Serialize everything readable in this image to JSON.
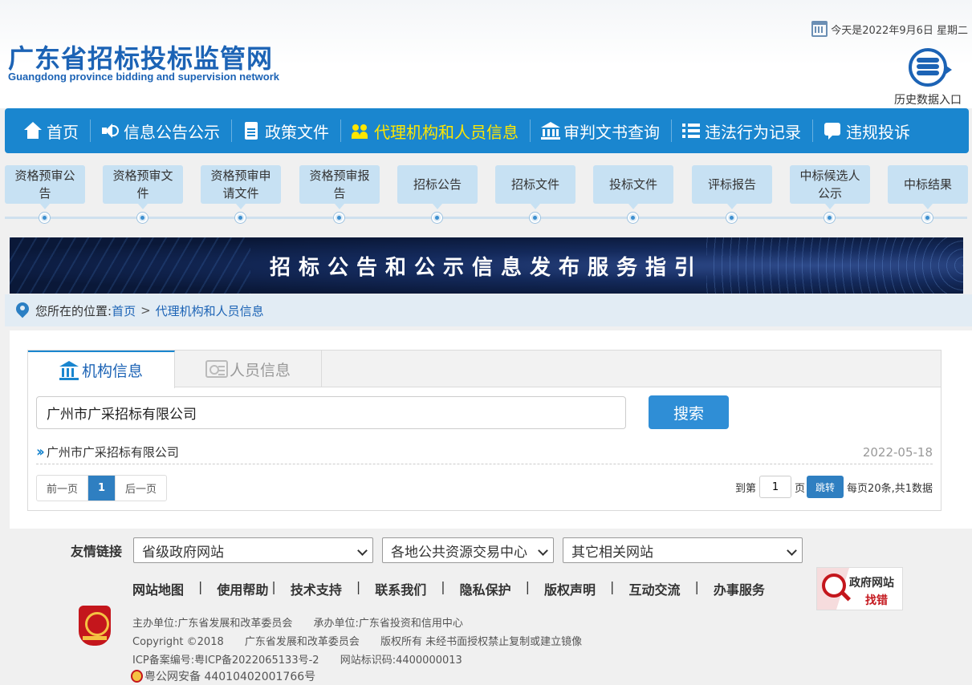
{
  "header": {
    "site_title": "广东省招标投标监管网",
    "site_subtitle": "Guangdong province bidding and supervision network",
    "date_text": "今天是2022年9月6日  星期二",
    "history_link": "历史数据入口"
  },
  "nav": {
    "items": [
      {
        "label": "首页",
        "icon": "home-icon"
      },
      {
        "label": "信息公告公示",
        "icon": "speaker-icon"
      },
      {
        "label": "政策文件",
        "icon": "document-icon"
      },
      {
        "label": "代理机构和人员信息",
        "icon": "people-icon",
        "active": true
      },
      {
        "label": "审判文书查询",
        "icon": "courthouse-icon"
      },
      {
        "label": "违法行为记录",
        "icon": "list-icon"
      },
      {
        "label": "违规投诉",
        "icon": "chat-icon"
      }
    ],
    "active_color": "#ffe600",
    "bar_color": "#1a86cf"
  },
  "steps": [
    "资格预审公告",
    "资格预审文件",
    "资格预审申请文件",
    "资格预审报告",
    "招标公告",
    "招标文件",
    "投标文件",
    "评标报告",
    "中标候选人公示",
    "中标结果"
  ],
  "banner": {
    "title": "招标公告和公示信息发布服务指引"
  },
  "breadcrumb": {
    "prefix": "您所在的位置:",
    "home": "首页",
    "separator": ">",
    "current": "代理机构和人员信息"
  },
  "tabs": [
    {
      "label": "机构信息",
      "icon": "bank-icon",
      "active": true
    },
    {
      "label": "人员信息",
      "icon": "id-card-icon",
      "active": false
    }
  ],
  "search": {
    "value": "广州市广采招标有限公司",
    "button_label": "搜索"
  },
  "results": [
    {
      "name": "广州市广采招标有限公司",
      "date": "2022-05-18"
    }
  ],
  "pagination": {
    "prev_label": "前一页",
    "current_page": "1",
    "next_label": "后一页",
    "jump_prefix": "到第",
    "jump_value": "1",
    "jump_suffix": "页",
    "jump_button": "跳转",
    "summary": "每页20条,共1数据"
  },
  "footer": {
    "links_label": "友情链接",
    "selects": [
      "省级政府网站",
      "各地公共资源交易中心",
      "其它相关网站"
    ],
    "nav": [
      "网站地图",
      "使用帮助",
      "技术支持",
      "联系我们",
      "隐私保护",
      "版权声明",
      "互动交流",
      "办事服务"
    ],
    "nav_separator": "|",
    "gov_badge_line1": "政府网站",
    "gov_badge_line2": "找错",
    "host": "主办单位:广东省发展和改革委员会",
    "undertaker": "承办单位:广东省投资和信用中心",
    "copyright": "Copyright ©2018",
    "copyright_owner": "广东省发展和改革委员会",
    "rights": "版权所有 未经书面授权禁止复制或建立镜像",
    "icp": "ICP备案编号:粤ICP备2022065133号-2",
    "site_code": "网站标识码:4400000013",
    "police": "粤公网安备 44010402001766号"
  }
}
